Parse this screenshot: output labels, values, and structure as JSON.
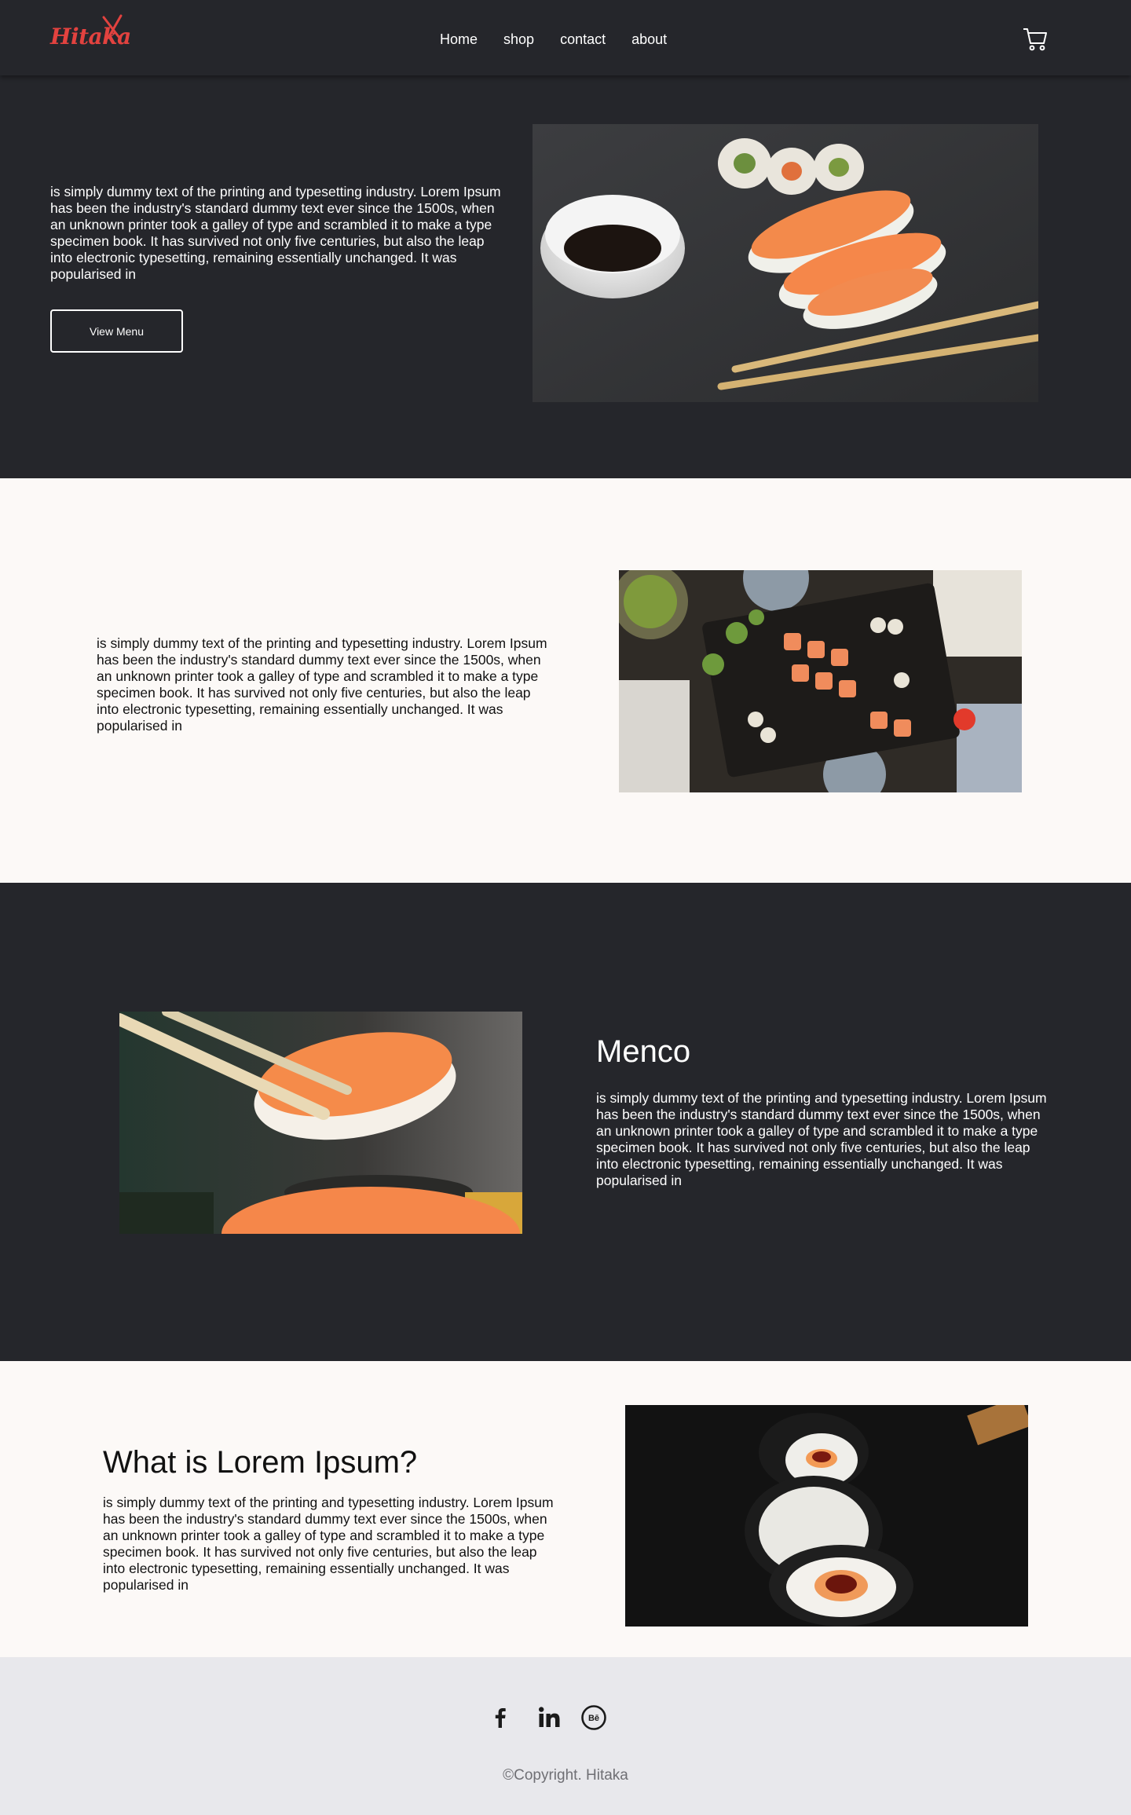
{
  "brand": {
    "logo_text": "Hitaka",
    "logo_color": "#e2423f"
  },
  "nav": {
    "items": [
      {
        "label": "Home"
      },
      {
        "label": "shop"
      },
      {
        "label": "contact"
      },
      {
        "label": "about"
      }
    ],
    "cart_icon": "cart-icon"
  },
  "hero": {
    "text": "is simply dummy text of the printing and typesetting industry. Lorem Ipsum has been the industry's standard dummy text ever since the 1500s, when an unknown printer took a galley of type and scrambled it to make a type specimen book. It has survived not only five centuries, but also the leap into electronic typesetting, remaining essentially unchanged. It was popularised in",
    "button_label": "View Menu"
  },
  "section_two": {
    "text": "is simply dummy text of the printing and typesetting industry. Lorem Ipsum has been the industry's standard dummy text ever since the 1500s, when an unknown printer took a galley of type and scrambled it to make a type specimen book. It has survived not only five centuries, but also the leap into electronic typesetting, remaining essentially unchanged. It was popularised in"
  },
  "section_three": {
    "heading": "Menco",
    "text": "is simply dummy text of the printing and typesetting industry. Lorem Ipsum has been the industry's standard dummy text ever since the 1500s, when an unknown printer took a galley of type and scrambled it to make a type specimen book. It has survived not only five centuries, but also the leap into electronic typesetting, remaining essentially unchanged. It was popularised in"
  },
  "section_four": {
    "heading": "What is Lorem Ipsum?",
    "text": "is simply dummy text of the printing and typesetting industry. Lorem Ipsum has been the industry's standard dummy text ever since the 1500s, when an unknown printer took a galley of type and scrambled it to make a type specimen book. It has survived not only five centuries, but also the leap into electronic typesetting, remaining essentially unchanged. It was popularised in"
  },
  "footer": {
    "social_icons": [
      "facebook-icon",
      "linkedin-icon",
      "behance-icon"
    ],
    "copyright": "©Copyright. Hitaka"
  },
  "colors": {
    "dark_bg": "#25262b",
    "light_bg": "#fcf9f7",
    "footer_bg": "#e8e8ec",
    "accent": "#e2423f"
  }
}
